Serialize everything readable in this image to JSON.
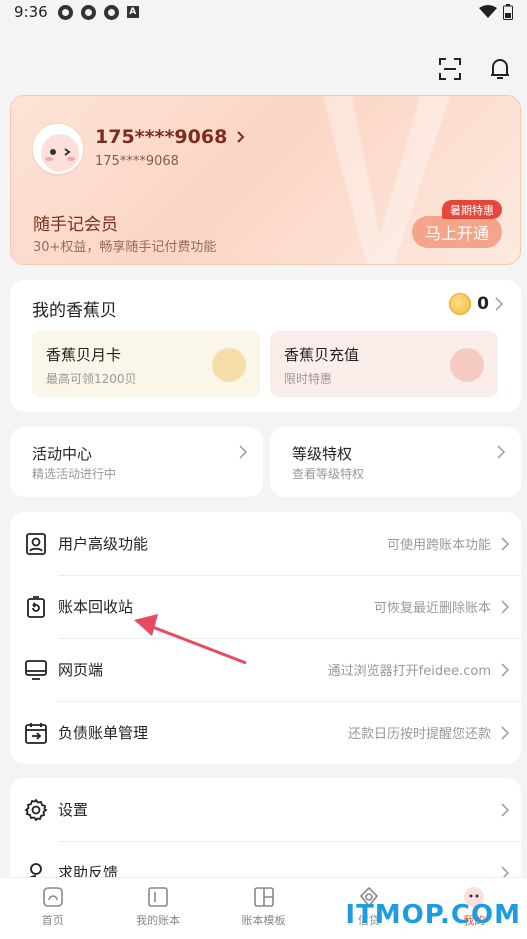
{
  "status_bar": {
    "time": "9:36",
    "badge": "A"
  },
  "member": {
    "phone_masked": "175****9068",
    "phone_sub": "175****9068",
    "vip_title": "随手记会员",
    "vip_desc": "30+权益，畅享随手记付费功能",
    "promo_badge": "暑期特惠",
    "open_button": "马上开通",
    "accent": "#f3a48a"
  },
  "banana": {
    "title": "我的香蕉贝",
    "count": "0",
    "tiles": [
      {
        "title": "香蕉贝月卡",
        "subtitle": "最高可领1200贝"
      },
      {
        "title": "香蕉贝充值",
        "subtitle": "限时特惠"
      }
    ]
  },
  "quick": [
    {
      "title": "活动中心",
      "subtitle": "精选活动进行中"
    },
    {
      "title": "等级特权",
      "subtitle": "查看等级特权"
    }
  ],
  "menu": [
    {
      "label": "用户高级功能",
      "hint": "可使用跨账本功能",
      "icon": "user-badge-icon"
    },
    {
      "label": "账本回收站",
      "hint": "可恢复最近删除账本",
      "icon": "recycle-bin-icon"
    },
    {
      "label": "网页端",
      "hint": "通过浏览器打开feidee.com",
      "icon": "monitor-icon"
    },
    {
      "label": "负债账单管理",
      "hint": "还款日历按时提醒您还款",
      "icon": "calendar-icon"
    }
  ],
  "menu2": [
    {
      "label": "设置",
      "hint": "",
      "icon": "gear-icon"
    },
    {
      "label": "求助反馈",
      "hint": "",
      "icon": "help-icon"
    }
  ],
  "tabs": [
    {
      "label": "首页"
    },
    {
      "label": "我的账本"
    },
    {
      "label": "账本模板"
    },
    {
      "label": "信贷"
    },
    {
      "label": "我的"
    }
  ],
  "watermark": "ITMOP.COM"
}
